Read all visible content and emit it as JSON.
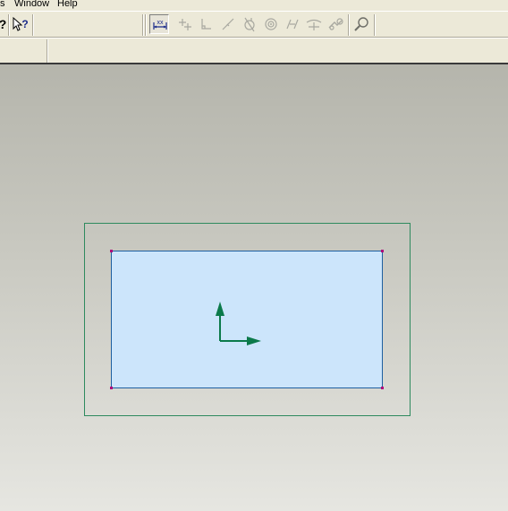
{
  "menubar": {
    "items": [
      {
        "label": "s",
        "name": "menu-tools"
      },
      {
        "label": "Window",
        "name": "menu-window"
      },
      {
        "label": "Help",
        "name": "menu-help"
      }
    ]
  },
  "toolbar": {
    "buttons": [
      {
        "name": "help-icon",
        "icon": "question-mark"
      },
      {
        "name": "whats-this-help-icon",
        "icon": "arrow-question"
      },
      {
        "name": "dimension-display-icon",
        "icon": "dimension-toggle",
        "active": true
      },
      {
        "name": "constraint-display-icon",
        "icon": "constraint-toggle"
      },
      {
        "name": "grid-display-icon",
        "icon": "grid-toggle"
      },
      {
        "name": "vertex-display-icon",
        "icon": "vertex-toggle"
      },
      {
        "name": "analysis-icon",
        "icon": "analysis"
      },
      {
        "name": "center-point-icon",
        "icon": "center-point"
      },
      {
        "name": "parallel-icon",
        "icon": "parallel"
      },
      {
        "name": "tangent-icon",
        "icon": "tangent"
      },
      {
        "name": "trim-icon",
        "icon": "trim"
      },
      {
        "name": "zoom-icon",
        "icon": "magnifier"
      }
    ]
  },
  "viewport": {
    "colors": {
      "background_top": "#b5b5ac",
      "background_bottom": "#e6e6e1",
      "outer_frame": "#2e8a5e",
      "surface_fill": "#cce5fb",
      "surface_border": "#1e5fa0",
      "vertex": "#b0007a",
      "csys_axis": "#0b7a4a"
    }
  }
}
